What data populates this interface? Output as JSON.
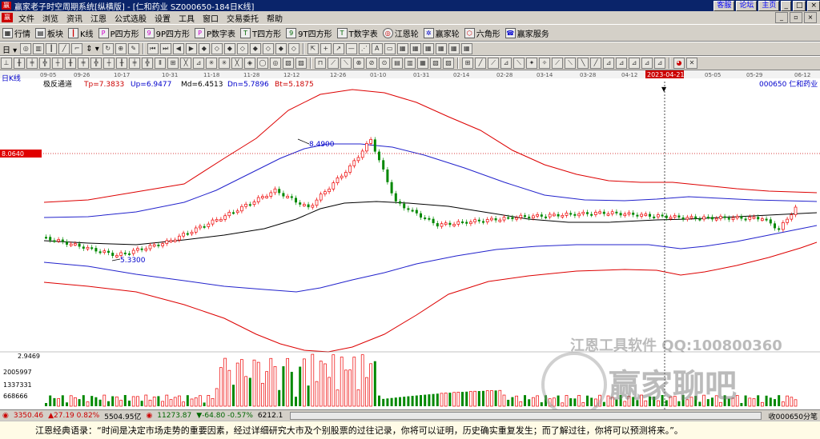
{
  "window": {
    "title": "赢家老子时空周期系统[纵横版] - [仁和药业  SZ000650-184日K线]",
    "buttons": [
      "客服",
      "论坛",
      "主页"
    ]
  },
  "menu": {
    "items": [
      "文件",
      "浏览",
      "资讯",
      "江恩",
      "公式选股",
      "设置",
      "工具",
      "窗口",
      "交易委托",
      "帮助"
    ]
  },
  "toolbar1": {
    "items": [
      "行情",
      "板块",
      "K线",
      "P四方形",
      "9P四方形",
      "P数字表",
      "T四方形",
      "9T四方形",
      "T数字表",
      "江恩轮",
      "赢家轮",
      "六角形",
      "赢家服务"
    ]
  },
  "chart": {
    "period_label": "日K线",
    "indicator_name": "极反通道",
    "tp": "Tp=7.3833",
    "up": "Up=6.9477",
    "md": "Md=6.4513",
    "dn": "Dn=5.7896",
    "bt": "Bt=5.1875",
    "stock": "000650  仁和药业",
    "price_marker": "8.0640",
    "high_label": "8.4900",
    "low_label": "5.3300",
    "cursor_date": "2023-04-21",
    "date_ticks": [
      "09-05",
      "09-26",
      "10-17",
      "10-31",
      "11-18",
      "11-28",
      "12-12",
      "12-26",
      "01-10",
      "01-31",
      "02-14",
      "02-28",
      "03-14",
      "03-28",
      "04-12",
      "05-05",
      "05-29",
      "06-12"
    ],
    "vol_axis": [
      "2.9469",
      "2005997",
      "1337331",
      "668666"
    ],
    "watermark1": "江恩工具软件  QQ:100800360",
    "watermark2": "赢家聊吧"
  },
  "status": {
    "idx1": "3350.46",
    "idx1_chg": "▲27.19 0.82%",
    "idx1_amt": "5504.95亿",
    "idx2": "11273.87",
    "idx2_chg": "▼-64.80 -0.57%",
    "idx2_amt": "6212.1",
    "right": "收000650分笔"
  },
  "quote": "江恩经典语录：“时间是决定市场走势的重要因素，经过详细研究大市及个别股票的过往记录，你将可以证明，历史确实重复发生；而了解过往，你将可以预测将来。”。",
  "colors": {
    "up": "#ff0000",
    "down": "#008000",
    "titlebar": "#0a246a"
  }
}
